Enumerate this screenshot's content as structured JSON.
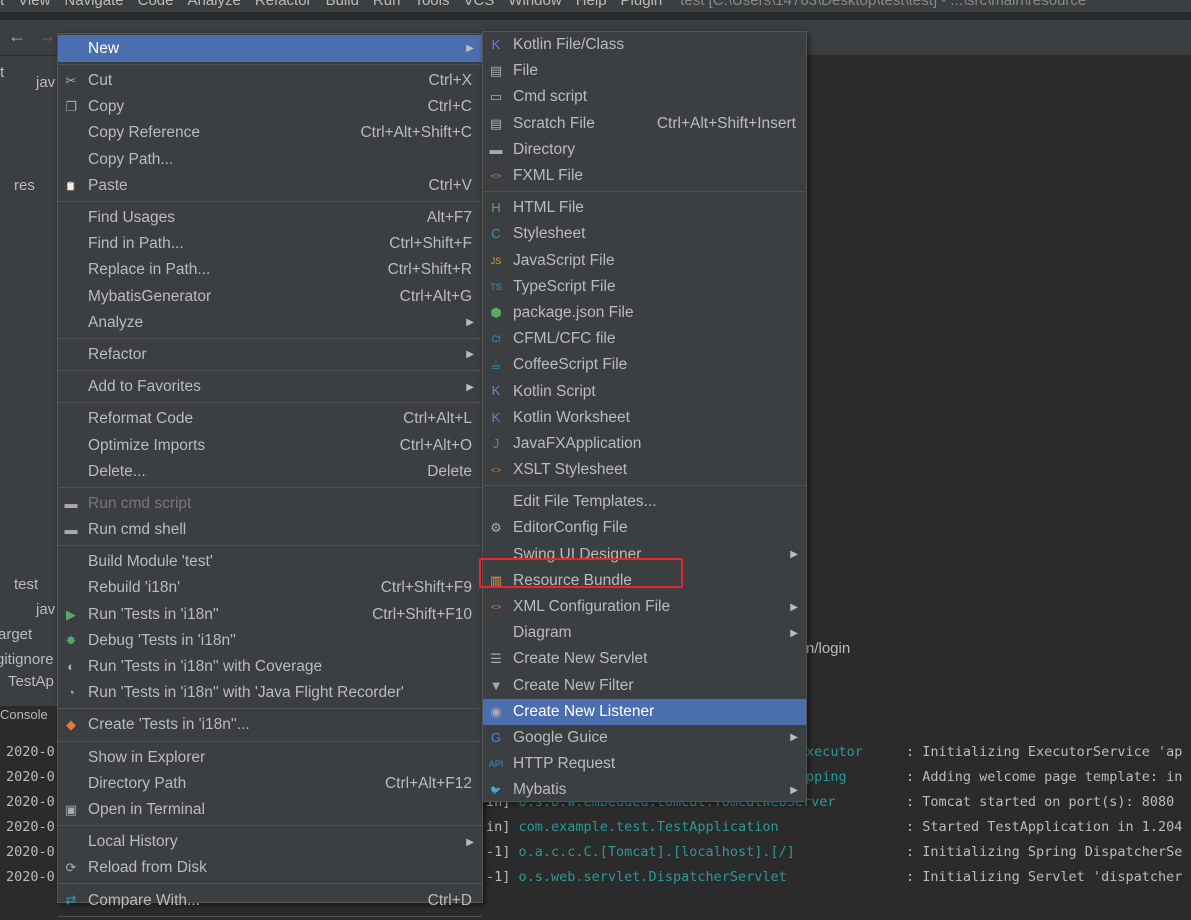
{
  "menubar": {
    "items": [
      "t",
      "View",
      "Navigate",
      "Code",
      "Analyze",
      "Refactor",
      "Build",
      "Run",
      "Tools",
      "VCS",
      "Window",
      "Help",
      "Plugin"
    ],
    "title": "test [C:\\Users\\14763\\Desktop\\test\\test] - ...\\src\\main\\resource"
  },
  "tree": {
    "items": [
      "jav",
      "res",
      "test",
      "jav",
      "arget",
      "gitignore",
      "TestAp",
      "Console"
    ],
    "project_label": "t"
  },
  "editor": {
    "visible_text": "n/login"
  },
  "context_menu": [
    {
      "label": "New",
      "arrow": true,
      "hl": true
    },
    {
      "sep": true
    },
    {
      "label": "Cut",
      "shortcut": "Ctrl+X",
      "icon": "✂"
    },
    {
      "label": "Copy",
      "shortcut": "Ctrl+C",
      "icon": "❐"
    },
    {
      "label": "Copy Reference",
      "shortcut": "Ctrl+Alt+Shift+C"
    },
    {
      "label": "Copy Path...",
      "icon": ""
    },
    {
      "label": "Paste",
      "shortcut": "Ctrl+V",
      "icon": "📋"
    },
    {
      "sep": true
    },
    {
      "label": "Find Usages",
      "shortcut": "Alt+F7"
    },
    {
      "label": "Find in Path...",
      "shortcut": "Ctrl+Shift+F"
    },
    {
      "label": "Replace in Path...",
      "shortcut": "Ctrl+Shift+R"
    },
    {
      "label": "MybatisGenerator",
      "shortcut": "Ctrl+Alt+G"
    },
    {
      "label": "Analyze",
      "arrow": true
    },
    {
      "sep": true
    },
    {
      "label": "Refactor",
      "arrow": true
    },
    {
      "sep": true
    },
    {
      "label": "Add to Favorites",
      "arrow": true
    },
    {
      "sep": true
    },
    {
      "label": "Reformat Code",
      "shortcut": "Ctrl+Alt+L"
    },
    {
      "label": "Optimize Imports",
      "shortcut": "Ctrl+Alt+O"
    },
    {
      "label": "Delete...",
      "shortcut": "Delete"
    },
    {
      "sep": true
    },
    {
      "label": "Run cmd script",
      "icon": "▬",
      "disabled": true
    },
    {
      "label": "Run cmd shell",
      "icon": "▬"
    },
    {
      "sep": true
    },
    {
      "label": "Build Module 'test'"
    },
    {
      "label": "Rebuild 'i18n'",
      "shortcut": "Ctrl+Shift+F9"
    },
    {
      "label": "Run 'Tests in 'i18n''",
      "shortcut": "Ctrl+Shift+F10",
      "icon": "▶",
      "color": "#59a869"
    },
    {
      "label": "Debug 'Tests in 'i18n''",
      "icon": "✸",
      "color": "#59a869"
    },
    {
      "label": "Run 'Tests in 'i18n'' with Coverage",
      "icon": "◐"
    },
    {
      "label": "Run 'Tests in 'i18n'' with 'Java Flight Recorder'",
      "icon": "◔"
    },
    {
      "sep": true
    },
    {
      "label": "Create 'Tests in 'i18n''...",
      "icon": "◆",
      "color": "#e07b39"
    },
    {
      "sep": true
    },
    {
      "label": "Show in Explorer"
    },
    {
      "label": "Directory Path",
      "shortcut": "Ctrl+Alt+F12"
    },
    {
      "label": "Open in Terminal",
      "icon": "▣"
    },
    {
      "sep": true
    },
    {
      "label": "Local History",
      "arrow": true
    },
    {
      "label": "Reload from Disk",
      "icon": "⟳"
    },
    {
      "sep": true
    },
    {
      "label": "Compare With...",
      "shortcut": "Ctrl+D",
      "icon": "⇄",
      "color": "#3592c4"
    },
    {
      "sep": true
    }
  ],
  "submenu": [
    {
      "label": "Kotlin File/Class",
      "icon": "K",
      "color": "#8a6fd8"
    },
    {
      "label": "File",
      "icon": "▤"
    },
    {
      "label": "Cmd script",
      "icon": "▭"
    },
    {
      "label": "Scratch File",
      "shortcut": "Ctrl+Alt+Shift+Insert",
      "icon": "▤"
    },
    {
      "label": "Directory",
      "icon": "▬"
    },
    {
      "label": "FXML File",
      "icon": "<>",
      "color": "#e07b39"
    },
    {
      "sep": true
    },
    {
      "label": "HTML File",
      "icon": "H",
      "color": "#59a869"
    },
    {
      "label": "Stylesheet",
      "icon": "C",
      "color": "#3592c4"
    },
    {
      "label": "JavaScript File",
      "icon": "JS",
      "color": "#d9a343"
    },
    {
      "label": "TypeScript File",
      "icon": "TS",
      "color": "#3592c4"
    },
    {
      "label": "package.json File",
      "icon": "⬢",
      "color": "#59a869"
    },
    {
      "label": "CFML/CFC file",
      "icon": "Cf",
      "color": "#3592c4"
    },
    {
      "label": "CoffeeScript File",
      "icon": "☕",
      "color": "#3592c4"
    },
    {
      "label": "Kotlin Script",
      "icon": "K",
      "color": "#8a6fd8"
    },
    {
      "label": "Kotlin Worksheet",
      "icon": "K",
      "color": "#8a6fd8"
    },
    {
      "label": "JavaFXApplication",
      "icon": "J",
      "color": "#3592c4"
    },
    {
      "label": "XSLT Stylesheet",
      "icon": "<>",
      "color": "#e07b39"
    },
    {
      "sep": true
    },
    {
      "label": "Edit File Templates..."
    },
    {
      "label": "EditorConfig File",
      "icon": "⚙"
    },
    {
      "label": "Swing UI Designer",
      "arrow": true
    },
    {
      "label": "Resource Bundle",
      "icon": "▥",
      "color": "#d9a343"
    },
    {
      "label": "XML Configuration File",
      "arrow": true,
      "icon": "<>",
      "color": "#e07b39"
    },
    {
      "label": "Diagram",
      "arrow": true
    },
    {
      "label": "Create New Servlet",
      "icon": "☰"
    },
    {
      "label": "Create New Filter",
      "icon": "▼"
    },
    {
      "label": "Create New Listener",
      "icon": "◉",
      "hl": true
    },
    {
      "label": "Google Guice",
      "arrow": true,
      "icon": "G",
      "color": "#4285f4"
    },
    {
      "label": "HTTP Request",
      "icon": "API",
      "color": "#3592c4"
    },
    {
      "label": "Mybatis",
      "arrow": true,
      "icon": "🐦",
      "color": "#c33"
    }
  ],
  "console": {
    "lines": [
      {
        "date": "2020-0",
        "cls": "xecutor",
        "msg": ": Initializing ExecutorService 'ap"
      },
      {
        "date": "2020-0",
        "cls": "pping",
        "msg": ": Adding welcome page template: in"
      },
      {
        "date": "2020-0",
        "pre": "in] ",
        "cls": "o.s.b.w.embedded.tomcat.TomcatWebServer",
        "msg": ": Tomcat started on port(s): 8080"
      },
      {
        "date": "2020-0",
        "pre": "in] ",
        "cls": "com.example.test.TestApplication",
        "msg": ": Started TestApplication in 1.204"
      },
      {
        "date": "2020-0",
        "pre": "-1] ",
        "cls": "o.a.c.c.C.[Tomcat].[localhost].[/]",
        "msg": ": Initializing Spring DispatcherSe"
      },
      {
        "date": "2020-0",
        "pre": "-1] ",
        "cls": "o.s.web.servlet.DispatcherServlet",
        "msg": ": Initializing Servlet 'dispatcher"
      }
    ]
  }
}
